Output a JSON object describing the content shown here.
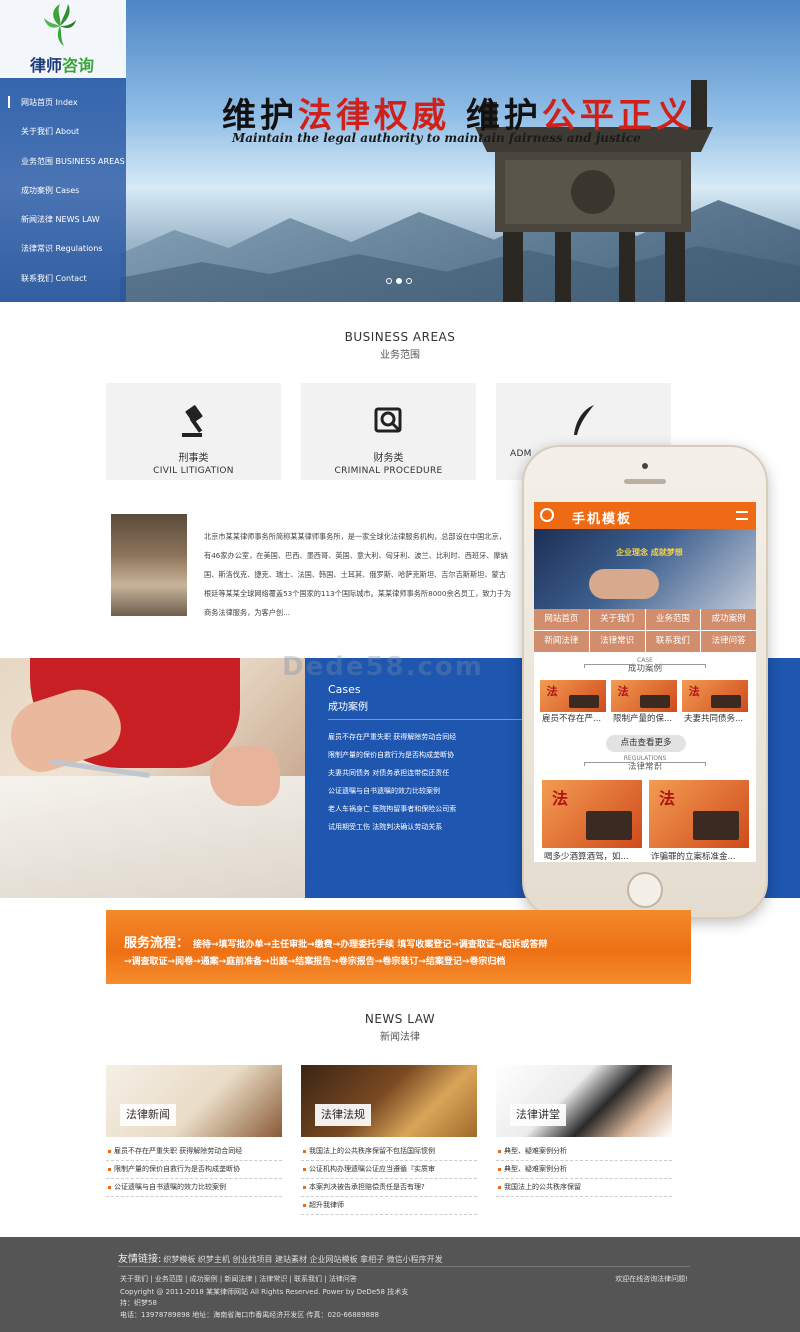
{
  "logo": {
    "text_a": "律师",
    "text_b": "咨询"
  },
  "nav": [
    {
      "label": "网站首页 Index"
    },
    {
      "label": "关于我们 About"
    },
    {
      "label": "业务范围 BUSINESS AREAS"
    },
    {
      "label": "成功案例 Cases"
    },
    {
      "label": "新闻法律 NEWS LAW"
    },
    {
      "label": "法律常识 Regulations"
    },
    {
      "label": "联系我们 Contact"
    }
  ],
  "hero": {
    "slogan_1": "维护",
    "slogan_2": "法律权威",
    "slogan_3": "维护",
    "slogan_4": "公平正义",
    "slogan_en": "Maintain the legal authority to maintain fairness and justice"
  },
  "business": {
    "title_en": "BUSINESS AREAS",
    "title_cn": "业务范围",
    "cards": [
      {
        "cn": "刑事类",
        "en": "CIVIL LITIGATION",
        "icon": "gavel-icon"
      },
      {
        "cn": "财务类",
        "en": "CRIMINAL PROCEDURE",
        "icon": "magnifier-icon"
      },
      {
        "cn": "",
        "en": "ADM",
        "icon": "quill-icon"
      }
    ]
  },
  "about": {
    "lines": [
      "北京市某某律师事务所简称某某律师事务所，是一家全球化法律服务机构，总部设在中国北京，",
      "有46家办公室，在美国、巴西、墨西哥、英国、意大利、匈牙利、波兰、比利时、西班牙、摩纳",
      "国、斯洛伐克、捷克、瑞士、法国、韩国、土耳其、俄罗斯、哈萨克斯坦、吉尔吉斯斯坦、蒙古",
      "根廷等某某全球网络覆盖53个国家的113个国际城市。某某律师事务所8000余名员工，致力于为",
      "商务法律服务，为客户创..."
    ]
  },
  "cases": {
    "title_en": "Cases",
    "title_cn": "成功案例",
    "items": [
      "雇员不存在严重失职 获得解除劳动合同经",
      "限制产量的保价自救行为是否构成垄断协",
      "夫妻共同债务 对债务承担连带偿还责任",
      "公证遗嘱与自书遗嘱的效力比较案例",
      "老人车祸身亡 医院拘留事者和保险公司索",
      "试用期受工伤 法院判决确认劳动关系"
    ]
  },
  "phone": {
    "app_title": "手机模板",
    "banner_text": "企业理念 成就梦想",
    "nav": [
      "网站首页",
      "关于我们",
      "业务范围",
      "成功案例",
      "新闻法律",
      "法律常识",
      "联系我们",
      "法律问答"
    ],
    "case_en": "CASE",
    "case_cn": "成功案例",
    "case_items": [
      "雇员不存在严...",
      "限制产量的保...",
      "夫妻共同债务..."
    ],
    "more_label": "点击查看更多",
    "reg_en": "REGULATIONS",
    "reg_cn": "法律常识",
    "reg_items": [
      "喝多少酒算酒驾，如...",
      "诈骗罪的立案标准金..."
    ]
  },
  "watermark": "Dede58.com",
  "process": {
    "label": "服务流程：",
    "line1": "接待→填写批办单→主任审批→缴费→办理委托手续 填写收案登记→调查取证→起诉或答辩",
    "line2": "→调查取证→阅卷→通案→庭前准备→出庭→结案报告→卷宗报告→卷宗装订→结案登记→卷宗归档"
  },
  "news": {
    "title_en": "NEWS LAW",
    "title_cn": "新闻法律",
    "cols": [
      {
        "caption": "法律新闻",
        "items": [
          "雇员不存在严重失职 获得解除劳动合同经",
          "限制产量的保价自救行为是否构成垄断协",
          "公证遗嘱与自书遗嘱的效力比较案例"
        ]
      },
      {
        "caption": "法律法规",
        "items": [
          "我国法上的公共秩序保留不包括国际惯例",
          "公证机构办理遗嘱公证应当遵循『实质审",
          "本案判决被告承担赔偿责任是否有理?",
          "超升我律师"
        ]
      },
      {
        "caption": "法律讲堂",
        "items": [
          "典型、疑难案例分析",
          "典型、疑难案例分析",
          "我国法上的公共秩序保留"
        ]
      }
    ]
  },
  "footer": {
    "links_head": "友情链接:",
    "links": "织梦模板  织梦主机  创业找项目  建站素材  企业网站模板  拿相子  微信小程序开发",
    "nav": "关于我们 | 业务范围 | 成功案例 | 新闻法律 | 法律常识 | 联系我们 | 法律问答",
    "copyright": "Copyright @ 2011-2018 某某律师网站 All Rights Reserved. Power by DeDe58 技术支",
    "support": "持：织梦58",
    "contact": "电话：13978789898 地址：海南省海口市番禺经济开发区 传真：020-66889888",
    "welcome": "欢迎在线咨询法律问题!"
  },
  "colors": {
    "primary_blue": "#1e56b0",
    "orange": "#ef6a14",
    "red": "#d0201a",
    "green": "#3aa43a"
  }
}
